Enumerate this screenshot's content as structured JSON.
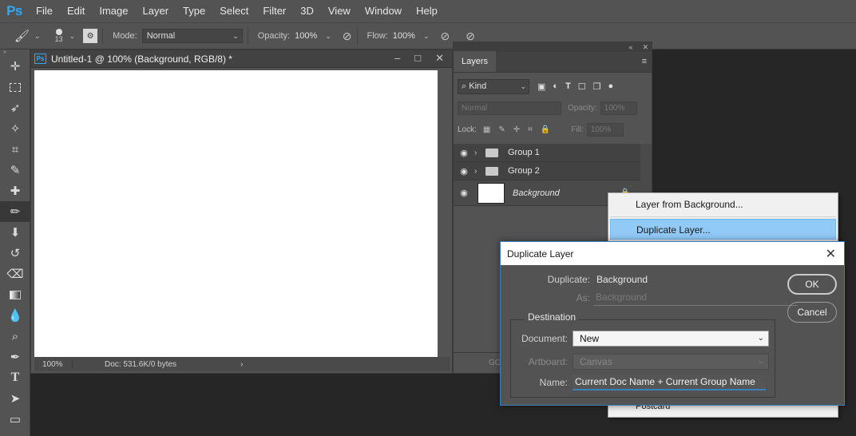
{
  "app": {
    "logo": "Ps"
  },
  "menu": [
    "File",
    "Edit",
    "Image",
    "Layer",
    "Type",
    "Select",
    "Filter",
    "3D",
    "View",
    "Window",
    "Help"
  ],
  "options": {
    "brush_size": "13",
    "mode_label": "Mode:",
    "mode_value": "Normal",
    "opacity_label": "Opacity:",
    "opacity_value": "100%",
    "flow_label": "Flow:",
    "flow_value": "100%"
  },
  "document": {
    "title": "Untitled-1 @ 100% (Background, RGB/8) *",
    "zoom": "100%",
    "doc_info": "Doc: 531.6K/0 bytes",
    "canvas_color": "#ffffff"
  },
  "layers_panel": {
    "tab": "Layers",
    "kind": "Kind",
    "blend": "Normal",
    "opacity_label": "Opacity:",
    "opacity_value": "100%",
    "lock_label": "Lock:",
    "fill_label": "Fill:",
    "fill_value": "100%",
    "layers": [
      {
        "name": "Group 1",
        "type": "group"
      },
      {
        "name": "Group 2",
        "type": "group"
      },
      {
        "name": "Background",
        "type": "background"
      }
    ],
    "bottom_text": "GO"
  },
  "context_menu": {
    "items": [
      "Layer from Background...",
      "Duplicate Layer..."
    ],
    "selected": "Duplicate Layer...",
    "bottom_item": "Postcard"
  },
  "dialog": {
    "title": "Duplicate Layer",
    "duplicate_label": "Duplicate:",
    "duplicate_value": "Background",
    "as_label": "As:",
    "as_value": "Background",
    "destination_label": "Destination",
    "document_label": "Document:",
    "document_value": "New",
    "artboard_label": "Artboard:",
    "artboard_value": "Canvas",
    "name_label": "Name:",
    "name_value": "Current Doc Name + Current  Group Name",
    "ok_label": "OK",
    "cancel_label": "Cancel",
    "accent_color": "#3c7fc1"
  }
}
